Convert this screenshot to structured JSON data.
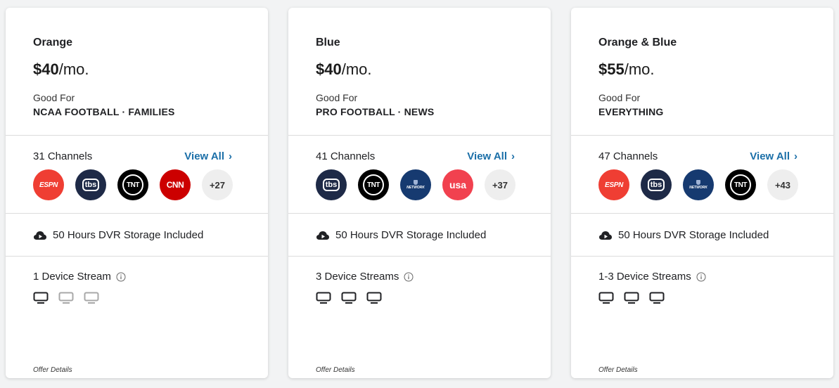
{
  "plans": [
    {
      "name": "Orange",
      "price": "$40",
      "per": "/mo.",
      "good_for_label": "Good For",
      "good_for": "NCAA FOOTBALL · FAMILIES",
      "channels_count": "31 Channels",
      "view_all": "View All",
      "channels": [
        {
          "icon": "espn-logo",
          "text": "ESPN"
        },
        {
          "icon": "tbs-logo",
          "text": "tbs"
        },
        {
          "icon": "tnt-logo",
          "text": "TNT"
        },
        {
          "icon": "cnn-logo",
          "text": "CNN"
        }
      ],
      "more": "+27",
      "dvr": "50 Hours DVR Storage Included",
      "streams": "1 Device Stream",
      "devices_active": 1,
      "devices_total": 3,
      "offer": "Offer Details"
    },
    {
      "name": "Blue",
      "price": "$40",
      "per": "/mo.",
      "good_for_label": "Good For",
      "good_for": "PRO FOOTBALL · NEWS",
      "channels_count": "41 Channels",
      "view_all": "View All",
      "channels": [
        {
          "icon": "tbs-logo",
          "text": "tbs"
        },
        {
          "icon": "tnt-logo",
          "text": "TNT"
        },
        {
          "icon": "nfl-network-logo",
          "text": "NETWORK"
        },
        {
          "icon": "usa-logo",
          "text": "usa"
        }
      ],
      "more": "+37",
      "dvr": "50 Hours DVR Storage Included",
      "streams": "3 Device Streams",
      "devices_active": 3,
      "devices_total": 3,
      "offer": "Offer Details"
    },
    {
      "name": "Orange & Blue",
      "price": "$55",
      "per": "/mo.",
      "good_for_label": "Good For",
      "good_for": "EVERYTHING",
      "channels_count": "47 Channels",
      "view_all": "View All",
      "channels": [
        {
          "icon": "espn-logo",
          "text": "ESPN"
        },
        {
          "icon": "tbs-logo",
          "text": "tbs"
        },
        {
          "icon": "nfl-network-logo",
          "text": "NETWORK"
        },
        {
          "icon": "tnt-logo",
          "text": "TNT"
        }
      ],
      "more": "+43",
      "dvr": "50 Hours DVR Storage Included",
      "streams": "1-3 Device Streams",
      "devices_active": 3,
      "devices_total": 3,
      "offer": "Offer Details"
    }
  ],
  "colors": {
    "link": "#1b6fa8",
    "espn": "#ef3e33",
    "tbs": "#1e2a47",
    "tnt": "#000000",
    "cnn": "#cc0000",
    "nfl": "#163a70",
    "usa": "#f1414f",
    "device_active": "#202124",
    "device_inactive": "#a8a8a8"
  },
  "icons": {
    "dvr": "cloud-play-icon",
    "info": "info-icon",
    "device": "tv-icon",
    "view_all": "chevron-right-icon"
  }
}
